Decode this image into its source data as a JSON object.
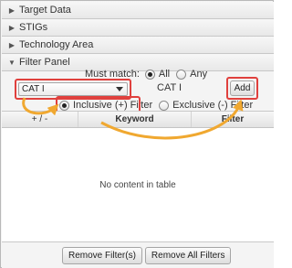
{
  "sections": [
    {
      "label": "Target Data",
      "arrow": "▶"
    },
    {
      "label": "STIGs",
      "arrow": "▶"
    },
    {
      "label": "Technology Area",
      "arrow": "▶"
    },
    {
      "label": "Filter Panel",
      "arrow": "▼"
    }
  ],
  "filter_panel": {
    "must_match_label": "Must match:",
    "must_match_options": [
      "All",
      "Any"
    ],
    "must_match_selected": "All",
    "combo_value": "CAT I",
    "preview_text": "CAT I",
    "add_label": "Add",
    "filter_type_options": [
      "Inclusive (+) Filter",
      "Exclusive (-) Filter"
    ],
    "filter_type_selected": "Inclusive (+) Filter"
  },
  "table": {
    "columns": [
      "+ / -",
      "Keyword",
      "Filter"
    ],
    "empty_message": "No content in table"
  },
  "buttons": {
    "remove_filters": "Remove Filter(s)",
    "remove_all_filters": "Remove All Filters"
  },
  "colors": {
    "highlight": "#e0403d",
    "callout_arrow": "#f0a830"
  }
}
